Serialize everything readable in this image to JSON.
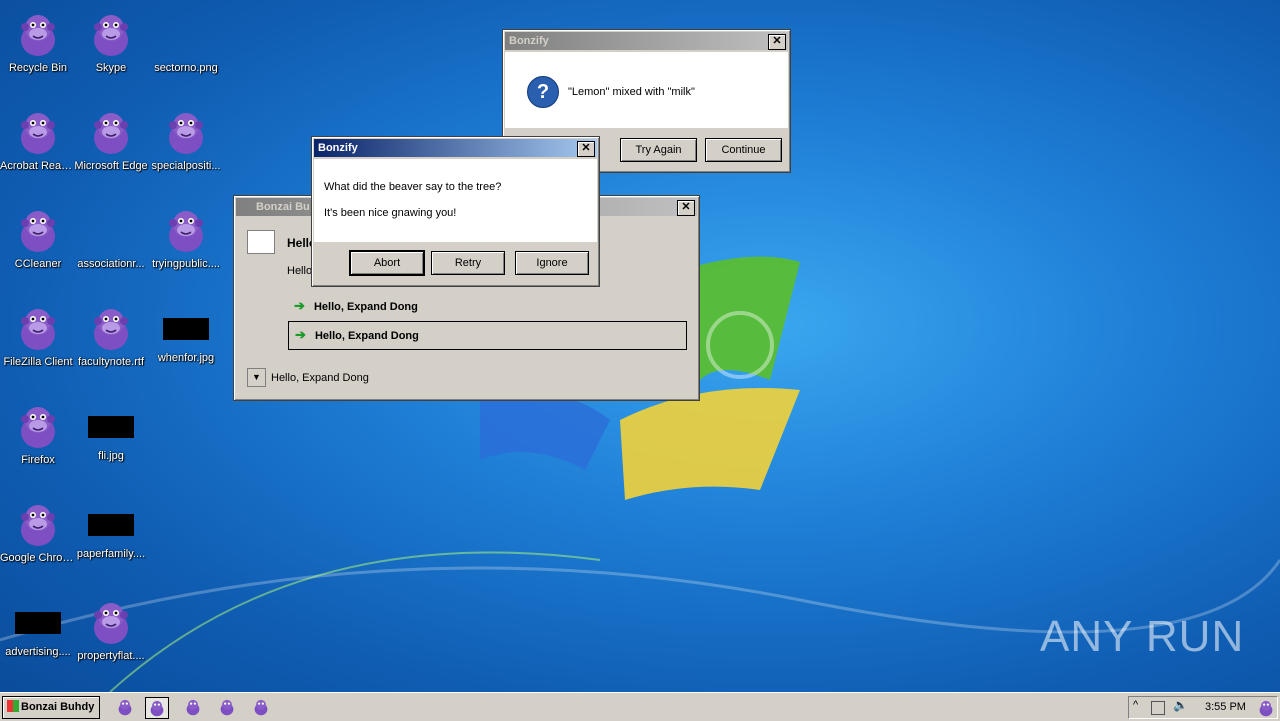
{
  "desktop": {
    "icons": [
      {
        "label": "Recycle Bin",
        "type": "bonzi"
      },
      {
        "label": "Skype",
        "type": "bonzi"
      },
      {
        "label": "sectorno.png",
        "type": "blank"
      },
      {
        "label": "Acrobat Reader DC",
        "type": "bonzi"
      },
      {
        "label": "Microsoft Edge",
        "type": "bonzi"
      },
      {
        "label": "specialpositi...",
        "type": "bonzi"
      },
      {
        "label": "CCleaner",
        "type": "bonzi"
      },
      {
        "label": "associationr...",
        "type": "blank"
      },
      {
        "label": "tryingpublic....",
        "type": "bonzi"
      },
      {
        "label": "FileZilla Client",
        "type": "bonzi"
      },
      {
        "label": "facultynote.rtf",
        "type": "bonzi"
      },
      {
        "label": "whenfor.jpg",
        "type": "black"
      },
      {
        "label": "Firefox",
        "type": "bonzi"
      },
      {
        "label": "fli.jpg",
        "type": "black"
      },
      {
        "label": "Google Chrome",
        "type": "bonzi"
      },
      {
        "label": "paperfamily....",
        "type": "black"
      },
      {
        "label": "advertising....",
        "type": "black"
      },
      {
        "label": "propertyflat....",
        "type": "bonzi"
      }
    ]
  },
  "dialog_lemon": {
    "title": "Bonzify",
    "message": "\"Lemon\" mixed with \"milk\"",
    "icon": "question-icon",
    "buttons": {
      "try_again": "Try Again",
      "continue": "Continue"
    }
  },
  "dialog_beaver": {
    "title": "Bonzify",
    "line1": "What did the beaver say to the tree?",
    "line2": "It's been nice gnawing you!",
    "buttons": {
      "abort": "Abort",
      "retry": "Retry",
      "ignore": "Ignore"
    }
  },
  "bonzai_window": {
    "title": "Bonzai Bu",
    "heading": "Hello",
    "subtext": "Hello",
    "option1": "Hello, Expand Dong",
    "option2": "Hello, Expand Dong",
    "expander": "Hello, Expand Dong"
  },
  "taskbar": {
    "start_label": "Bonzai Buhdy",
    "clock": "3:55 PM"
  },
  "watermark": "ANY RUN",
  "colors": {
    "bonzi_purple": "#8a5cc7",
    "title_active": "#0a246a"
  }
}
